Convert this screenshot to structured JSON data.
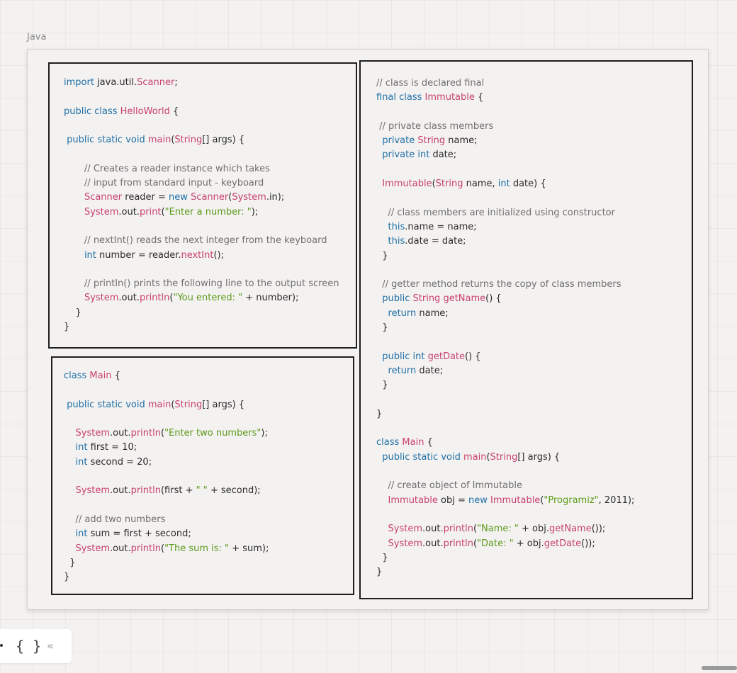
{
  "frame": {
    "label": "Java"
  },
  "box1": {
    "lines": [
      [
        [
          "kw",
          "import "
        ],
        [
          "pl",
          "java.util."
        ],
        [
          "ty",
          "Scanner"
        ],
        [
          "pl",
          ";"
        ]
      ],
      [],
      [
        [
          "kw",
          "public class "
        ],
        [
          "ty",
          "HelloWorld"
        ],
        [
          "pl",
          " {"
        ]
      ],
      [],
      [
        [
          "pl",
          " "
        ],
        [
          "kw",
          "public static void "
        ],
        [
          "ty",
          "main"
        ],
        [
          "pl",
          "("
        ],
        [
          "ty",
          "String"
        ],
        [
          "pl",
          "[] args) {"
        ]
      ],
      [],
      [
        [
          "cm",
          "       // Creates a reader instance which takes"
        ]
      ],
      [
        [
          "cm",
          "       // input from standard input - keyboard"
        ]
      ],
      [
        [
          "pl",
          "       "
        ],
        [
          "ty",
          "Scanner"
        ],
        [
          "pl",
          " reader = "
        ],
        [
          "kw",
          "new "
        ],
        [
          "ty",
          "Scanner"
        ],
        [
          "pl",
          "("
        ],
        [
          "ty",
          "System"
        ],
        [
          "pl",
          ".in);"
        ]
      ],
      [
        [
          "pl",
          "       "
        ],
        [
          "ty",
          "System"
        ],
        [
          "pl",
          ".out."
        ],
        [
          "ty",
          "print"
        ],
        [
          "pl",
          "("
        ],
        [
          "st",
          "\"Enter a number: \""
        ],
        [
          "pl",
          ");"
        ]
      ],
      [],
      [
        [
          "cm",
          "       // nextInt() reads the next integer from the keyboard"
        ]
      ],
      [
        [
          "pl",
          "       "
        ],
        [
          "kw",
          "int "
        ],
        [
          "pl",
          "number = reader."
        ],
        [
          "ty",
          "nextInt"
        ],
        [
          "pl",
          "();"
        ]
      ],
      [],
      [
        [
          "cm",
          "       // println() prints the following line to the output screen"
        ]
      ],
      [
        [
          "pl",
          "       "
        ],
        [
          "ty",
          "System"
        ],
        [
          "pl",
          ".out."
        ],
        [
          "ty",
          "println"
        ],
        [
          "pl",
          "("
        ],
        [
          "st",
          "\"You entered: \""
        ],
        [
          "pl",
          " + number);"
        ]
      ],
      [
        [
          "pl",
          "    }"
        ]
      ],
      [
        [
          "pl",
          "}"
        ]
      ]
    ]
  },
  "box2": {
    "lines": [
      [
        [
          "kw",
          "class "
        ],
        [
          "ty",
          "Main"
        ],
        [
          "pl",
          " {"
        ]
      ],
      [],
      [
        [
          "pl",
          " "
        ],
        [
          "kw",
          "public static void "
        ],
        [
          "ty",
          "main"
        ],
        [
          "pl",
          "("
        ],
        [
          "ty",
          "String"
        ],
        [
          "pl",
          "[] args) {"
        ]
      ],
      [],
      [
        [
          "pl",
          "    "
        ],
        [
          "ty",
          "System"
        ],
        [
          "pl",
          ".out."
        ],
        [
          "ty",
          "println"
        ],
        [
          "pl",
          "("
        ],
        [
          "st",
          "\"Enter two numbers\""
        ],
        [
          "pl",
          ");"
        ]
      ],
      [
        [
          "pl",
          "    "
        ],
        [
          "kw",
          "int "
        ],
        [
          "pl",
          "first = 10;"
        ]
      ],
      [
        [
          "pl",
          "    "
        ],
        [
          "kw",
          "int "
        ],
        [
          "pl",
          "second = 20;"
        ]
      ],
      [],
      [
        [
          "pl",
          "    "
        ],
        [
          "ty",
          "System"
        ],
        [
          "pl",
          ".out."
        ],
        [
          "ty",
          "println"
        ],
        [
          "pl",
          "(first + "
        ],
        [
          "st",
          "\" \""
        ],
        [
          "pl",
          " + second);"
        ]
      ],
      [],
      [
        [
          "cm",
          "    // add two numbers"
        ]
      ],
      [
        [
          "pl",
          "    "
        ],
        [
          "kw",
          "int "
        ],
        [
          "pl",
          "sum = first + second;"
        ]
      ],
      [
        [
          "pl",
          "    "
        ],
        [
          "ty",
          "System"
        ],
        [
          "pl",
          ".out."
        ],
        [
          "ty",
          "println"
        ],
        [
          "pl",
          "("
        ],
        [
          "st",
          "\"The sum is: \""
        ],
        [
          "pl",
          " + sum);"
        ]
      ],
      [
        [
          "pl",
          "  }"
        ]
      ],
      [
        [
          "pl",
          "}"
        ]
      ]
    ]
  },
  "box3": {
    "lines": [
      [
        [
          "cm",
          "// class is declared final"
        ]
      ],
      [
        [
          "kw",
          "final class "
        ],
        [
          "ty",
          "Immutable"
        ],
        [
          "pl",
          " {"
        ]
      ],
      [],
      [
        [
          "cm",
          " // private class members"
        ]
      ],
      [
        [
          "pl",
          "  "
        ],
        [
          "kw",
          "private "
        ],
        [
          "ty",
          "String"
        ],
        [
          "pl",
          " name;"
        ]
      ],
      [
        [
          "pl",
          "  "
        ],
        [
          "kw",
          "private int "
        ],
        [
          "pl",
          "date;"
        ]
      ],
      [],
      [
        [
          "pl",
          "  "
        ],
        [
          "ty",
          "Immutable"
        ],
        [
          "pl",
          "("
        ],
        [
          "ty",
          "String"
        ],
        [
          "pl",
          " name, "
        ],
        [
          "kw",
          "int "
        ],
        [
          "pl",
          "date) {"
        ]
      ],
      [],
      [
        [
          "cm",
          "    // class members are initialized using constructor"
        ]
      ],
      [
        [
          "pl",
          "    "
        ],
        [
          "kw",
          "this"
        ],
        [
          "pl",
          ".name = name;"
        ]
      ],
      [
        [
          "pl",
          "    "
        ],
        [
          "kw",
          "this"
        ],
        [
          "pl",
          ".date = date;"
        ]
      ],
      [
        [
          "pl",
          "  }"
        ]
      ],
      [],
      [
        [
          "cm",
          "  // getter method returns the copy of class members"
        ]
      ],
      [
        [
          "pl",
          "  "
        ],
        [
          "kw",
          "public "
        ],
        [
          "ty",
          "String"
        ],
        [
          "pl",
          " "
        ],
        [
          "ty",
          "getName"
        ],
        [
          "pl",
          "() {"
        ]
      ],
      [
        [
          "pl",
          "    "
        ],
        [
          "kw",
          "return "
        ],
        [
          "pl",
          "name;"
        ]
      ],
      [
        [
          "pl",
          "  }"
        ]
      ],
      [],
      [
        [
          "pl",
          "  "
        ],
        [
          "kw",
          "public int "
        ],
        [
          "ty",
          "getDate"
        ],
        [
          "pl",
          "() {"
        ]
      ],
      [
        [
          "pl",
          "    "
        ],
        [
          "kw",
          "return "
        ],
        [
          "pl",
          "date;"
        ]
      ],
      [
        [
          "pl",
          "  }"
        ]
      ],
      [],
      [
        [
          "pl",
          "}"
        ]
      ],
      [],
      [
        [
          "kw",
          "class "
        ],
        [
          "ty",
          "Main"
        ],
        [
          "pl",
          " {"
        ]
      ],
      [
        [
          "pl",
          "  "
        ],
        [
          "kw",
          "public static void "
        ],
        [
          "ty",
          "main"
        ],
        [
          "pl",
          "("
        ],
        [
          "ty",
          "String"
        ],
        [
          "pl",
          "[] args) {"
        ]
      ],
      [],
      [
        [
          "cm",
          "    // create object of Immutable"
        ]
      ],
      [
        [
          "pl",
          "    "
        ],
        [
          "ty",
          "Immutable"
        ],
        [
          "pl",
          " obj = "
        ],
        [
          "kw",
          "new "
        ],
        [
          "ty",
          "Immutable"
        ],
        [
          "pl",
          "("
        ],
        [
          "st",
          "\"Programiz\""
        ],
        [
          "pl",
          ", 2011);"
        ]
      ],
      [],
      [
        [
          "pl",
          "    "
        ],
        [
          "ty",
          "System"
        ],
        [
          "pl",
          ".out."
        ],
        [
          "ty",
          "println"
        ],
        [
          "pl",
          "("
        ],
        [
          "st",
          "\"Name: \""
        ],
        [
          "pl",
          " + obj."
        ],
        [
          "ty",
          "getName"
        ],
        [
          "pl",
          "());"
        ]
      ],
      [
        [
          "pl",
          "    "
        ],
        [
          "ty",
          "System"
        ],
        [
          "pl",
          ".out."
        ],
        [
          "ty",
          "println"
        ],
        [
          "pl",
          "("
        ],
        [
          "st",
          "\"Date: \""
        ],
        [
          "pl",
          " + obj."
        ],
        [
          "ty",
          "getDate"
        ],
        [
          "pl",
          "());"
        ]
      ],
      [
        [
          "pl",
          "  }"
        ]
      ],
      [
        [
          "pl",
          "}"
        ]
      ]
    ]
  },
  "toolbar": {
    "brace_icon_glyph": "{ }",
    "collapse_icon_glyph": "«"
  },
  "colors": {
    "keyword": "#1f6fa6",
    "type": "#c8406e",
    "string": "#5c9a1a",
    "comment": "#6f6f6f",
    "text": "#2b2b2b"
  }
}
